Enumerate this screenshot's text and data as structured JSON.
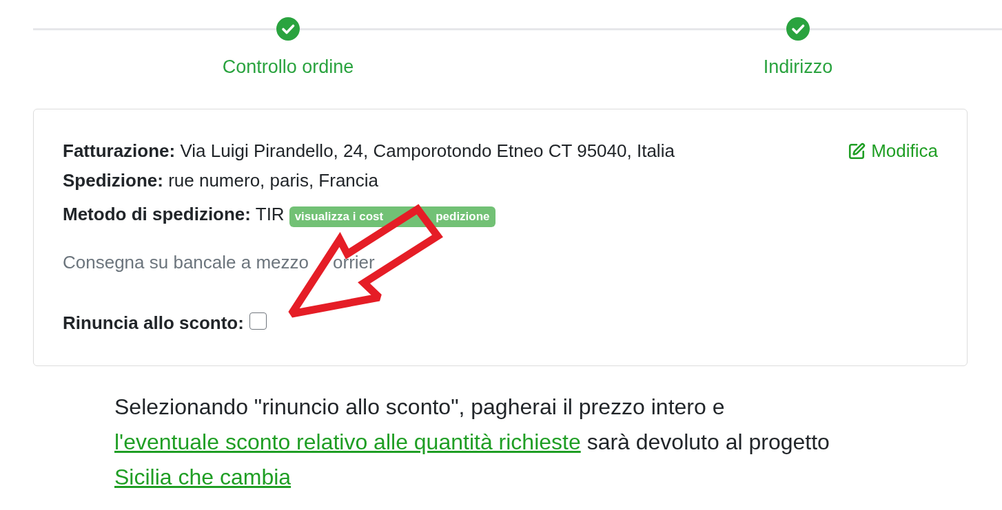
{
  "stepper": {
    "steps": [
      {
        "label": "Controllo ordine",
        "completed": true
      },
      {
        "label": "Indirizzo",
        "completed": true
      }
    ]
  },
  "summary": {
    "billing": {
      "label": "Fatturazione:",
      "value": "Via Luigi Pirandello, 24, Camporotondo Etneo CT 95040, Italia"
    },
    "shipping": {
      "label": "Spedizione:",
      "value": "rue numero, paris, Francia"
    },
    "edit_link": "Modifica",
    "shipping_method": {
      "label": "Metodo di spedizione:",
      "value": "TIR",
      "badge_parts": [
        "visualizza i cost",
        "pedizione"
      ]
    },
    "shipping_note_parts": [
      "Consegna su bancale a mezzo",
      "orrier"
    ],
    "discount_waiver": {
      "label": "Rinuncia allo sconto:",
      "checked": false
    }
  },
  "note": [
    {
      "kind": "text",
      "text": "Selezionando \"rinuncio allo sconto\", pagherai il prezzo intero e "
    },
    {
      "kind": "link",
      "text": "l'eventuale sconto relativo alle quantità richieste"
    },
    {
      "kind": "text",
      "text": " sarà devoluto al progetto "
    },
    {
      "kind": "link",
      "text": "Sicilia che cambia"
    }
  ]
}
